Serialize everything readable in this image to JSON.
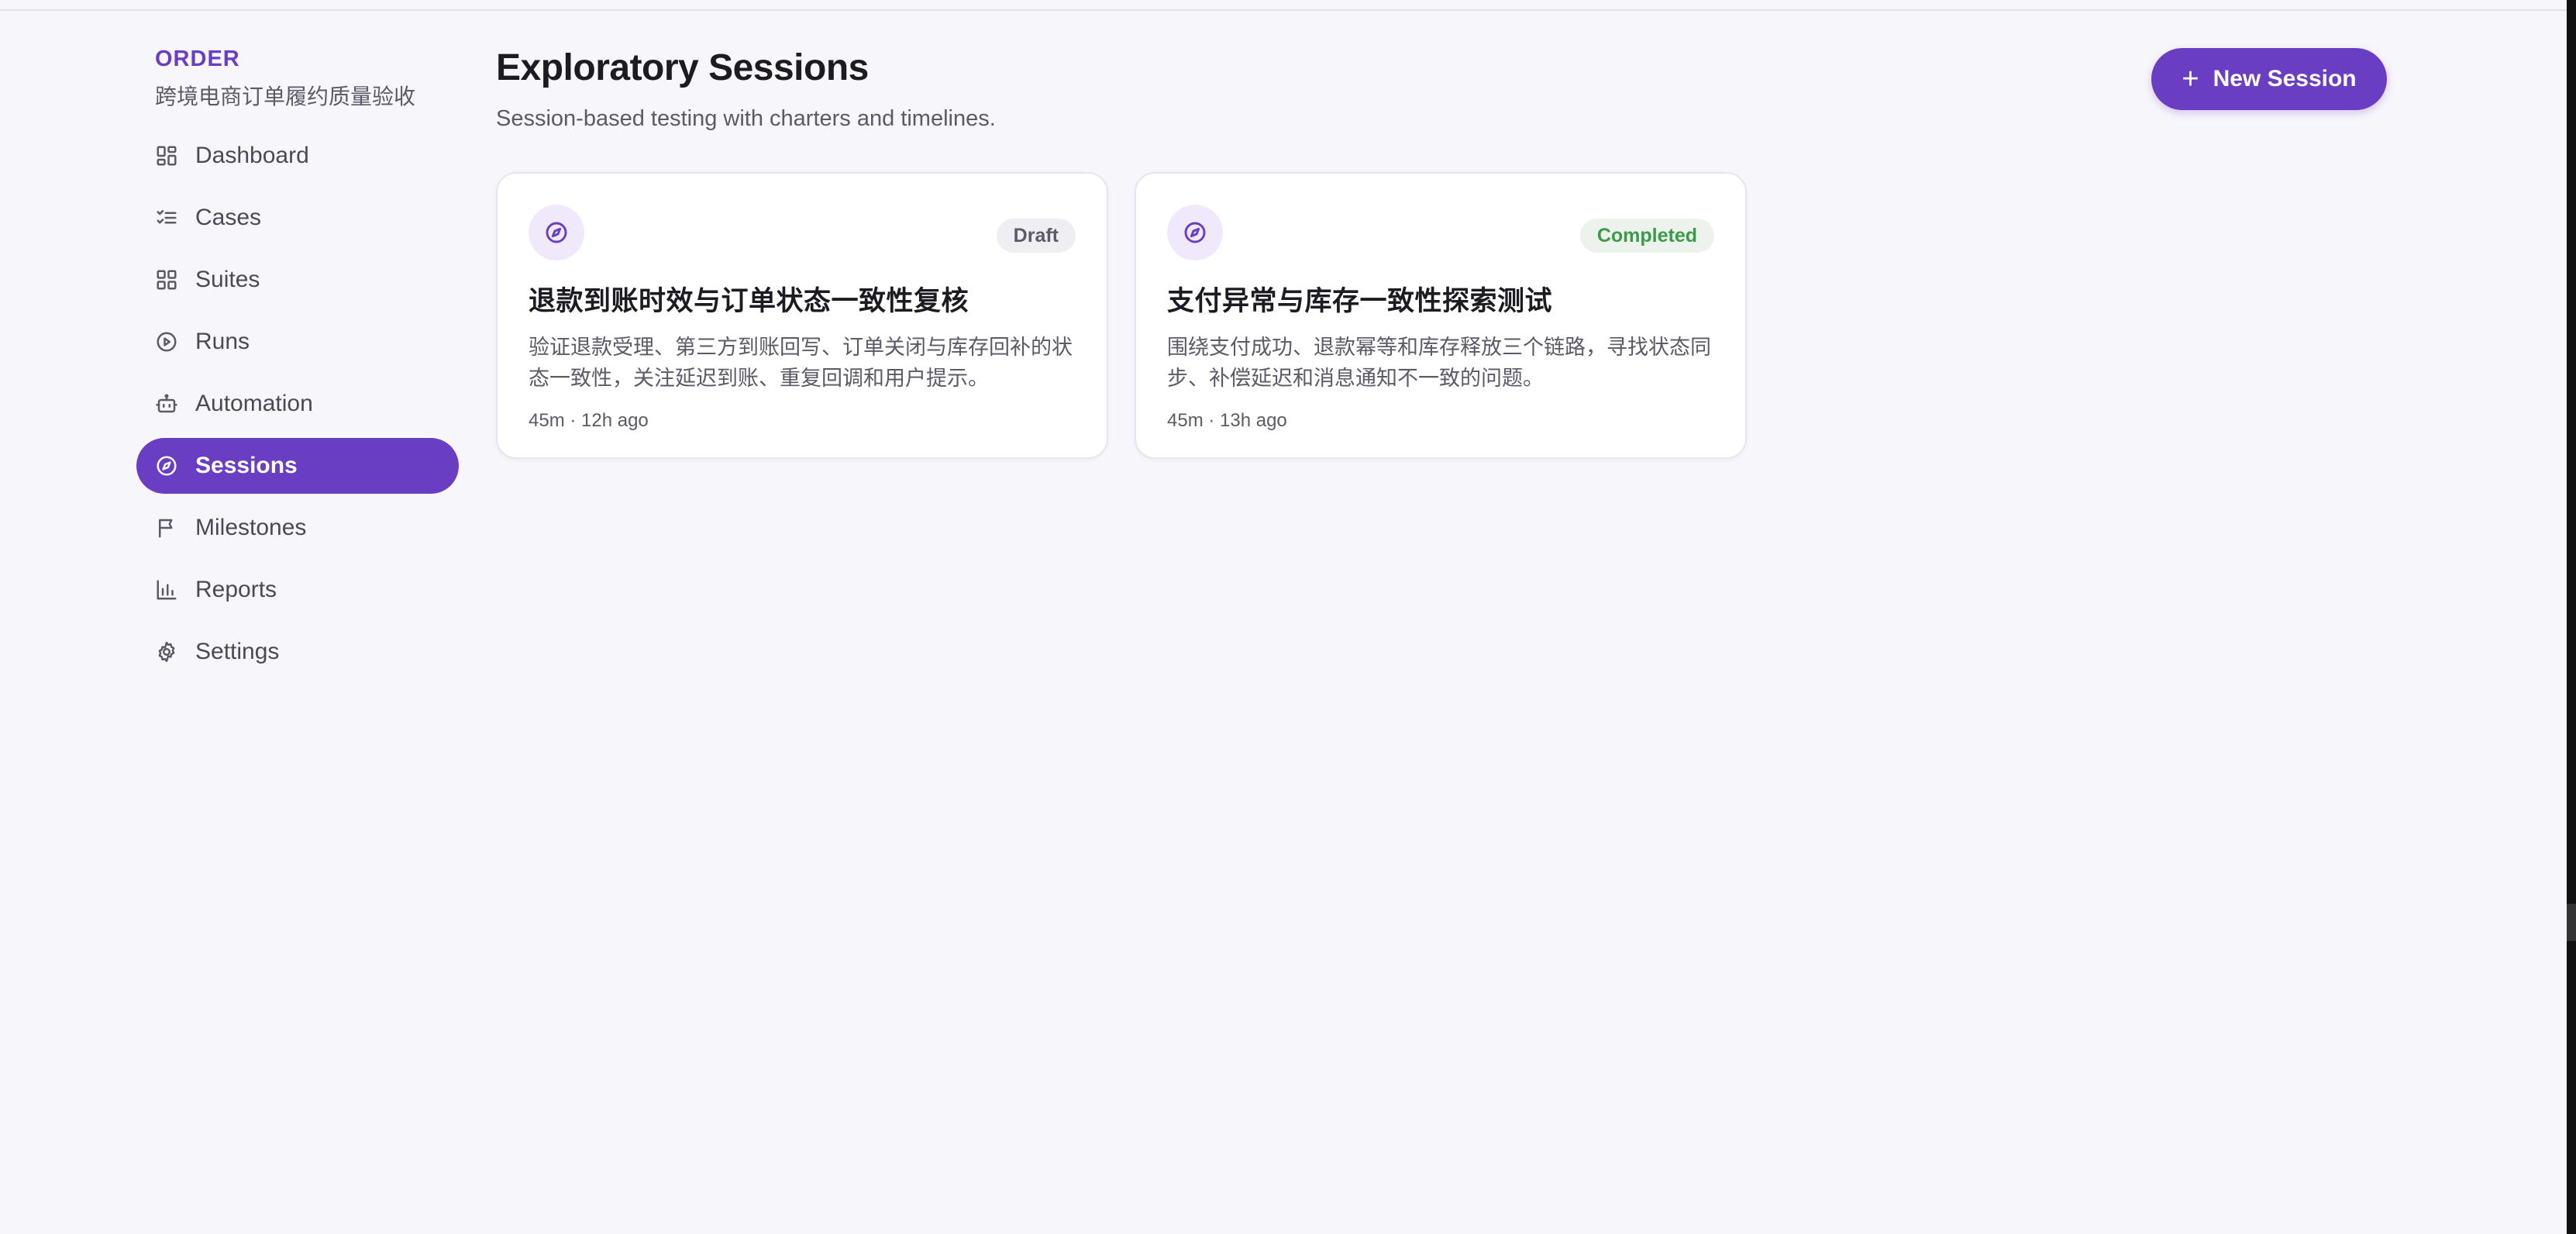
{
  "brand": {
    "name": "ORDER",
    "subtitle": "跨境电商订单履约质量验收"
  },
  "sidebar": {
    "items": [
      {
        "label": "Dashboard",
        "icon": "dashboard-icon"
      },
      {
        "label": "Cases",
        "icon": "checklist-icon"
      },
      {
        "label": "Suites",
        "icon": "grid-icon"
      },
      {
        "label": "Runs",
        "icon": "play-circle-icon"
      },
      {
        "label": "Automation",
        "icon": "robot-icon"
      },
      {
        "label": "Sessions",
        "icon": "compass-icon",
        "active": true
      },
      {
        "label": "Milestones",
        "icon": "flag-icon"
      },
      {
        "label": "Reports",
        "icon": "bar-chart-icon"
      },
      {
        "label": "Settings",
        "icon": "gear-icon"
      }
    ]
  },
  "header": {
    "title": "Exploratory Sessions",
    "subtitle": "Session-based testing with charters and timelines.",
    "new_button": "New Session"
  },
  "sessions": [
    {
      "status": "Draft",
      "title": "退款到账时效与订单状态一致性复核",
      "description": "验证退款受理、第三方到账回写、订单关闭与库存回补的状态一致性，关注延迟到账、重复回调和用户提示。",
      "meta": "45m · 12h ago"
    },
    {
      "status": "Completed",
      "title": "支付异常与库存一致性探索测试",
      "description": "围绕支付成功、退款幂等和库存释放三个链路，寻找状态同步、补偿延迟和消息通知不一致的问题。",
      "meta": "45m · 13h ago"
    }
  ],
  "colors": {
    "accent": "#6a3ec2",
    "background": "#f7f6fb",
    "completed": "#3a9a4a"
  }
}
